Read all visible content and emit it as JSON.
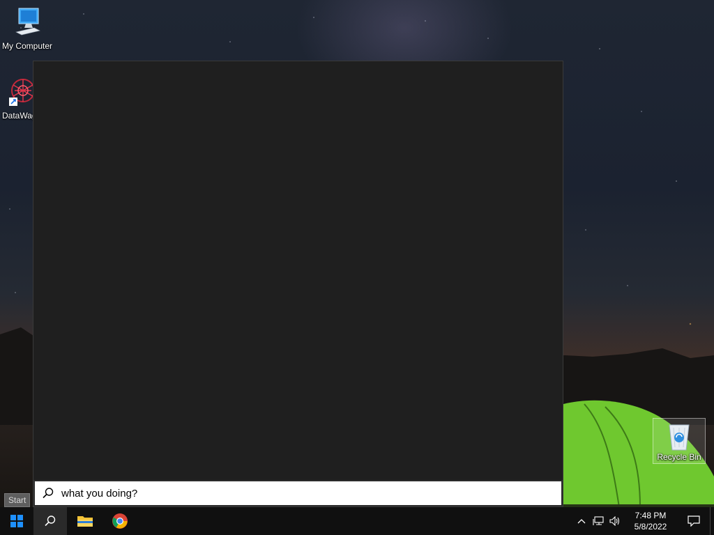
{
  "desktop": {
    "icons": [
      {
        "label": "My Computer"
      },
      {
        "label": "DataWag"
      },
      {
        "label": "Recycle Bin"
      }
    ]
  },
  "search": {
    "query": "what you doing?"
  },
  "tooltip": {
    "start": "Start"
  },
  "taskbar": {
    "pinned": [
      "windows-logo-icon",
      "search-icon",
      "file-explorer-icon",
      "chrome-icon"
    ],
    "tray": {
      "time": "7:48 PM",
      "date": "5/8/2022"
    }
  },
  "colors": {
    "panel_bg": "#1f1f1f",
    "taskbar_bg": "#101010",
    "windows_blue": "#1e90ff",
    "tent_green": "#7ccf3a"
  }
}
